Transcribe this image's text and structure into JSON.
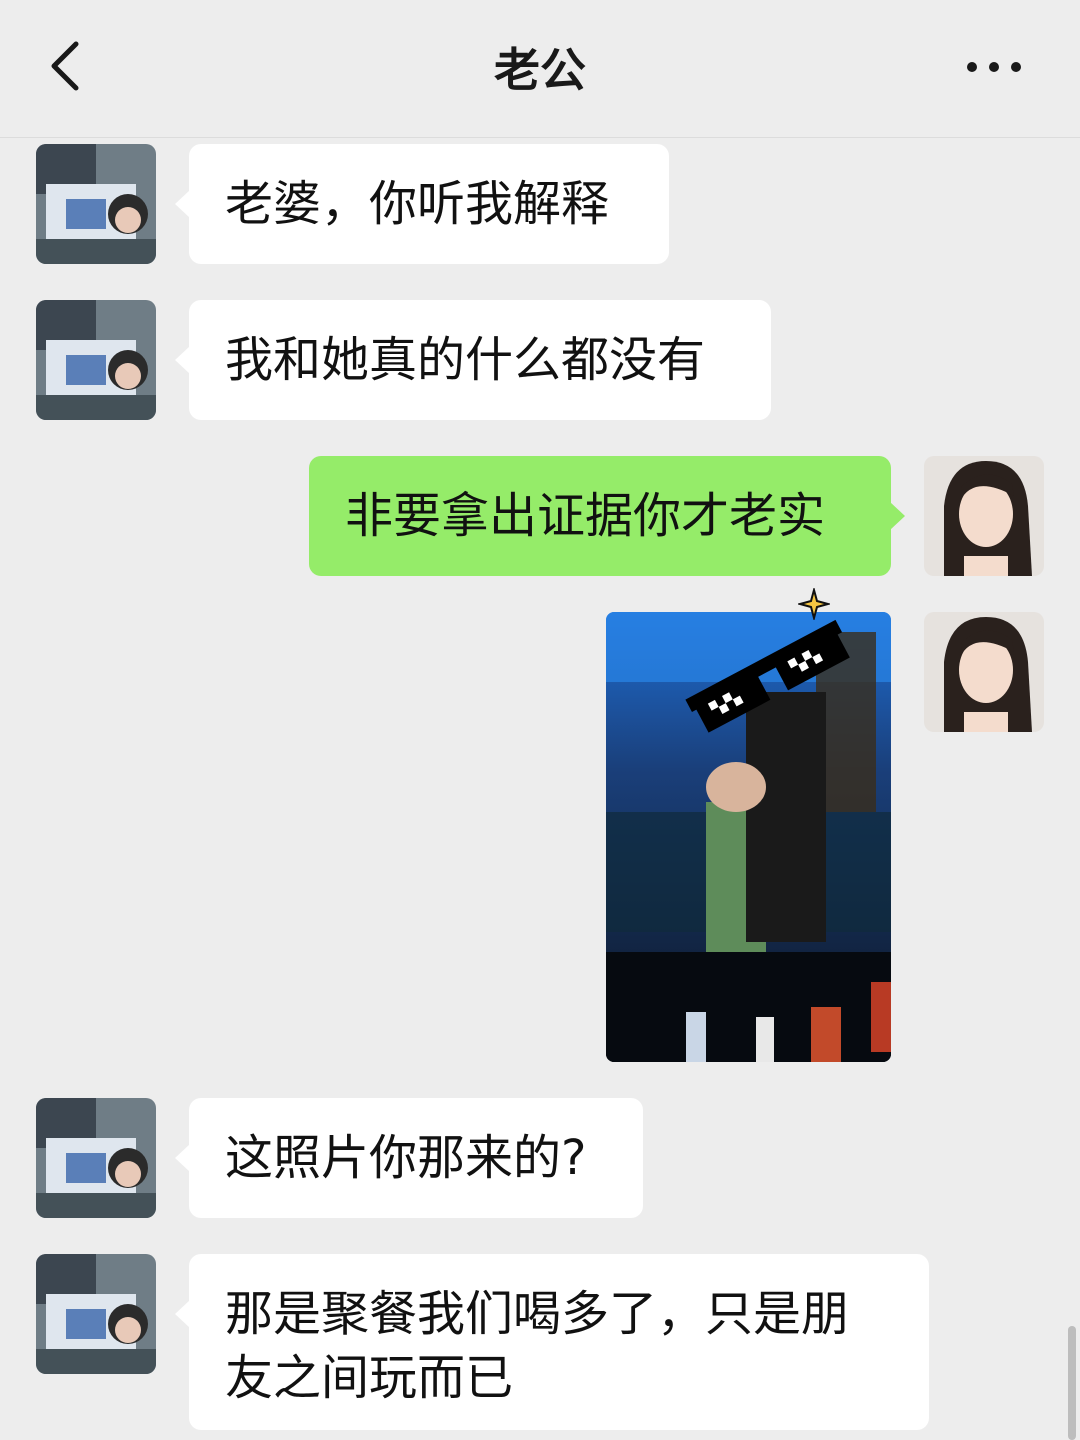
{
  "header": {
    "title": "老公",
    "back_icon": "chevron-left-icon",
    "more_icon": "more-dots-icon"
  },
  "messages": [
    {
      "side": "left",
      "type": "text",
      "text": "老婆，你听我解释"
    },
    {
      "side": "left",
      "type": "text",
      "text": "我和她真的什么都没有"
    },
    {
      "side": "right",
      "type": "text",
      "text": "非要拿出证据你才老实"
    },
    {
      "side": "right",
      "type": "image",
      "image": "nightclub-photo-with-pixel-sunglasses-sticker"
    },
    {
      "side": "left",
      "type": "text",
      "text": "这照片你那来的?"
    },
    {
      "side": "left",
      "type": "text",
      "text": "那是聚餐我们喝多了，只是朋友之间玩而已"
    }
  ],
  "colors": {
    "background": "#ededed",
    "incoming_bubble": "#ffffff",
    "outgoing_bubble": "#95ec69",
    "text": "#111111"
  }
}
